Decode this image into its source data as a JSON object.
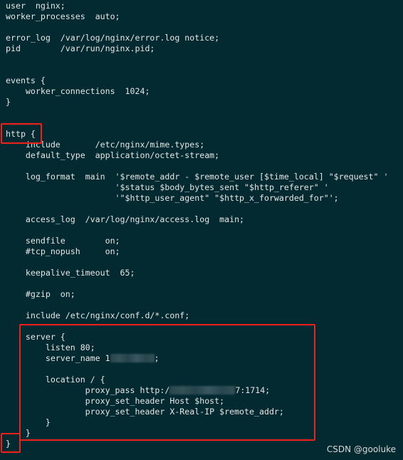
{
  "config_lines": [
    "user  nginx;",
    "worker_processes  auto;",
    "",
    "error_log  /var/log/nginx/error.log notice;",
    "pid        /var/run/nginx.pid;",
    "",
    "",
    "events {",
    "    worker_connections  1024;",
    "}",
    "",
    "",
    "http {",
    "    include       /etc/nginx/mime.types;",
    "    default_type  application/octet-stream;",
    "",
    "    log_format  main  '$remote_addr - $remote_user [$time_local] \"$request\" '",
    "                      '$status $body_bytes_sent \"$http_referer\" '",
    "                      '\"$http_user_agent\" \"$http_x_forwarded_for\"';",
    "",
    "    access_log  /var/log/nginx/access.log  main;",
    "",
    "    sendfile        on;",
    "    #tcp_nopush     on;",
    "",
    "    keepalive_timeout  65;",
    "",
    "    #gzip  on;",
    "",
    "    include /etc/nginx/conf.d/*.conf;",
    "",
    "    server {",
    "        listen 80;"
  ],
  "server_name_line": {
    "before": "        server_name 1",
    "after": ";"
  },
  "config_lines_2": [
    "",
    "        location / {"
  ],
  "proxy_pass_line": {
    "before": "                proxy_pass http:/",
    "after": "7:1714;"
  },
  "config_lines_3": [
    "                proxy_set_header Host $host;",
    "                proxy_set_header X-Real-IP $remote_addr;",
    "        }",
    "    }",
    "}"
  ],
  "watermark": "CSDN @gooluke",
  "colors": {
    "background": "#042a31",
    "text": "#e6e6e6",
    "highlight_box": "#f0201a"
  }
}
